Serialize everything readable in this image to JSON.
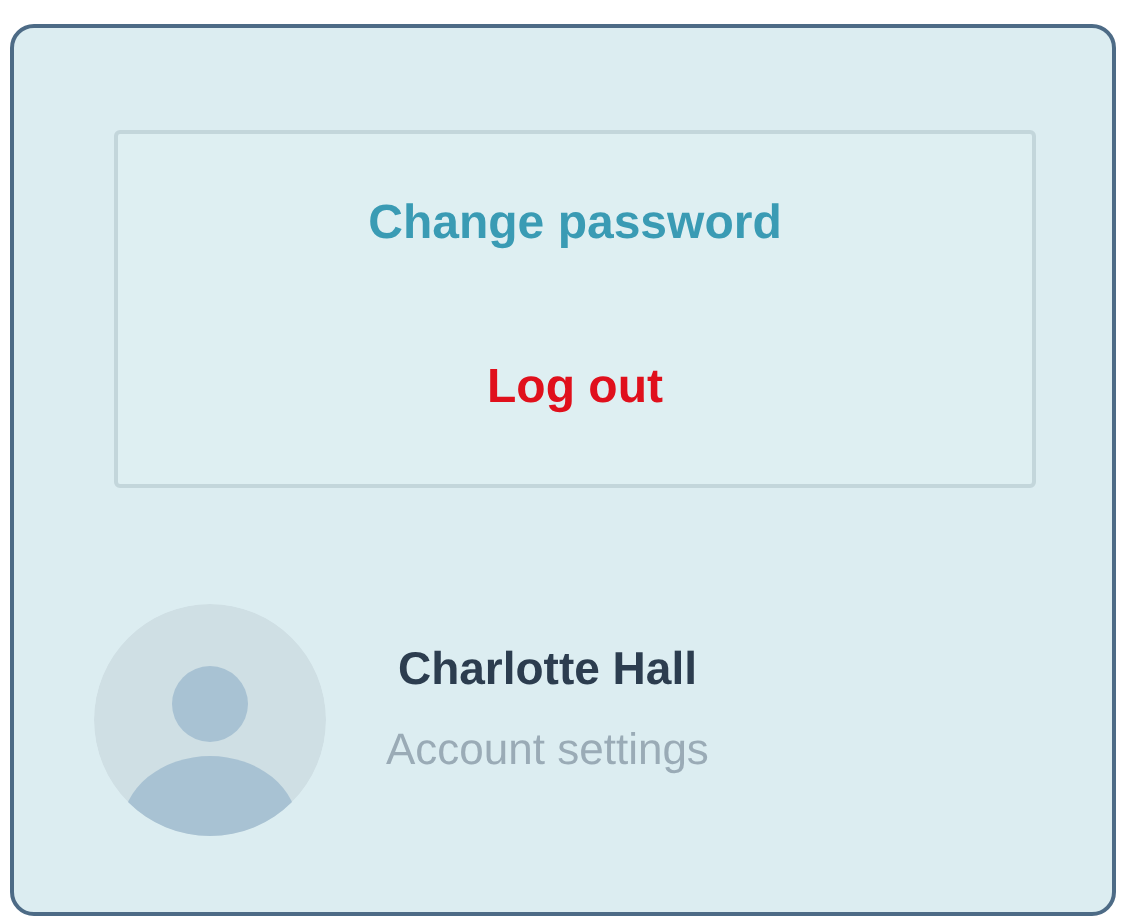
{
  "menu": {
    "items": [
      {
        "label": "Change password",
        "kind": "link"
      },
      {
        "label": "Log out",
        "kind": "danger"
      }
    ]
  },
  "profile": {
    "name": "Charlotte Hall",
    "subtitle": "Account settings"
  }
}
